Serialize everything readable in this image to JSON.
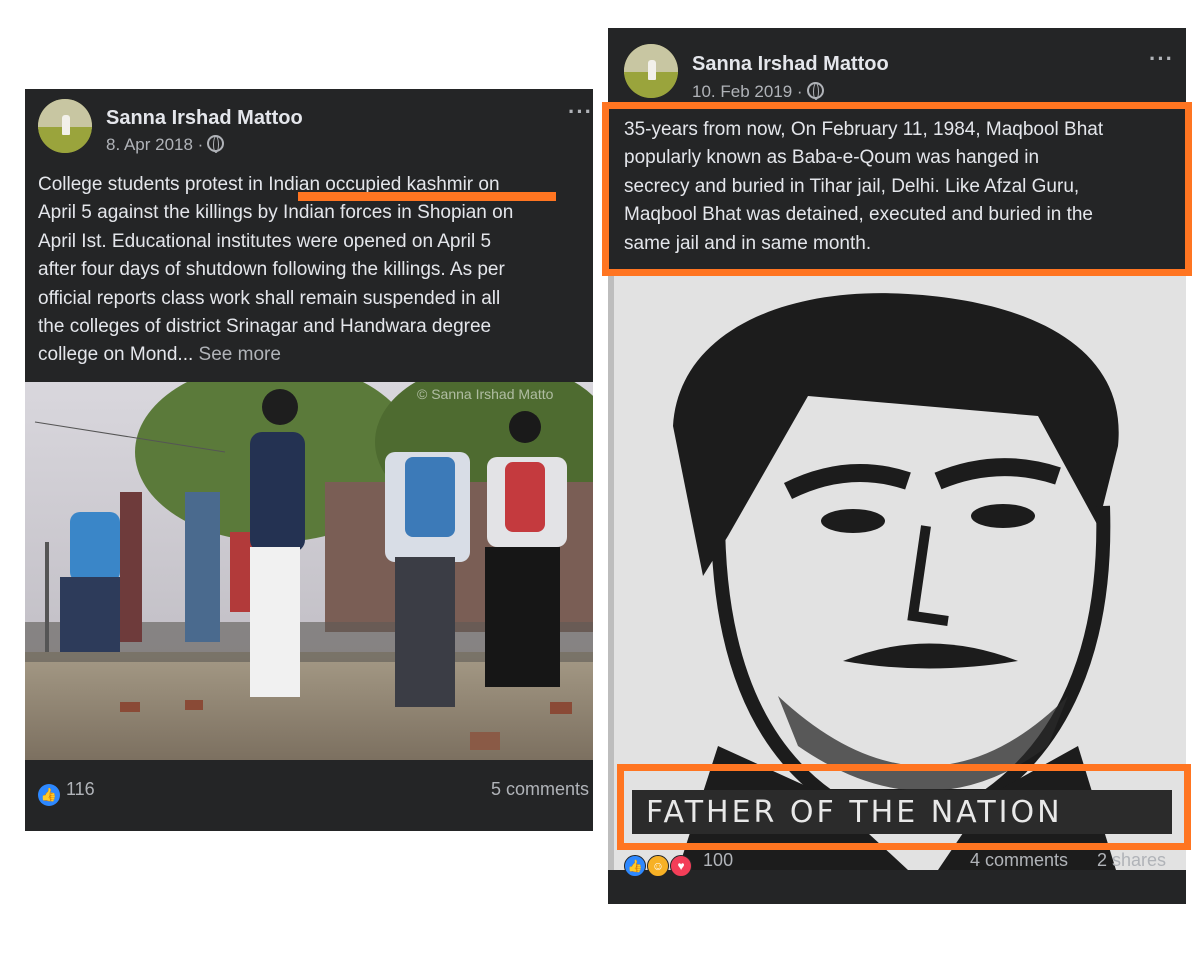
{
  "posts": [
    {
      "author": "Sanna Irshad Mattoo",
      "date": "8. Apr 2018 ·",
      "more_label": "···",
      "text_lines": [
        "College students protest in Indian occupied kashmir on",
        "April 5 against the killings by Indian forces in Shopian on",
        "April Ist. Educational institutes were opened on April 5",
        "after four days of shutdown following the killings. As per",
        "official reports class work shall remain suspended in all",
        "the colleges of district Srinagar  and Handwara  degree",
        "college on Mond..."
      ],
      "see_more": "See more",
      "watermark": "© Sanna Irshad Matto",
      "reaction_count": "116",
      "comments": "5 comments",
      "highlight": "Indian occupied kashmir"
    },
    {
      "author": "Sanna Irshad Mattoo",
      "date": "10. Feb 2019 ·",
      "more_label": "···",
      "text_lines": [
        "35-years from now, On February 11, 1984, Maqbool Bhat",
        "popularly known as Baba-e-Qoum was hanged in",
        "secrecy and buried in Tihar jail, Delhi. Like Afzal Guru,",
        "Maqbool Bhat was detained, executed and buried in the",
        "same jail and in same month."
      ],
      "poster_caption": "FATHER OF THE NATION",
      "reaction_count": "100",
      "comments": "4 comments",
      "shares": "2 shares"
    }
  ],
  "colors": {
    "highlight": "#ff7521",
    "post_bg": "#242526",
    "text": "#e4e6eb",
    "muted": "#b0b3b8"
  },
  "icons": [
    "globe-icon",
    "more-options-icon",
    "like-reaction-icon",
    "care-reaction-icon",
    "love-reaction-icon"
  ]
}
